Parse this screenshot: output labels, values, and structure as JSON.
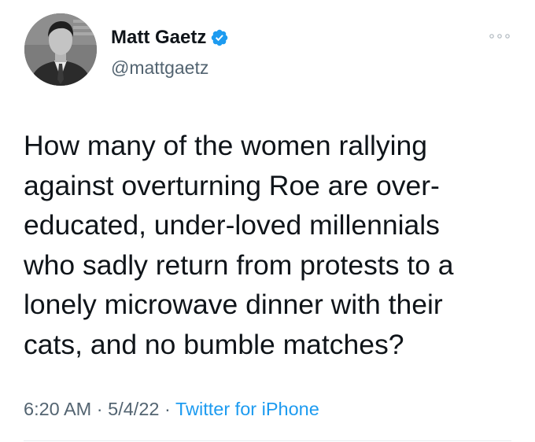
{
  "author": {
    "display_name": "Matt Gaetz",
    "handle": "@mattgaetz",
    "verified_icon": "verified-badge-icon",
    "avatar_icon": "profile-photo"
  },
  "tweet": {
    "text": "How many of the women rallying\nagainst overturning Roe are over-\neducated, under-loved millennials\nwho sadly return from protests to a\nlonely microwave dinner with their\ncats, and no bumble matches?",
    "time": "6:20 AM",
    "date": "5/4/22",
    "separator": "·",
    "source": "Twitter for iPhone"
  },
  "colors": {
    "text": "#0f1419",
    "secondary": "#536471",
    "link": "#1d9bf0",
    "verified": "#1d9bf0"
  }
}
